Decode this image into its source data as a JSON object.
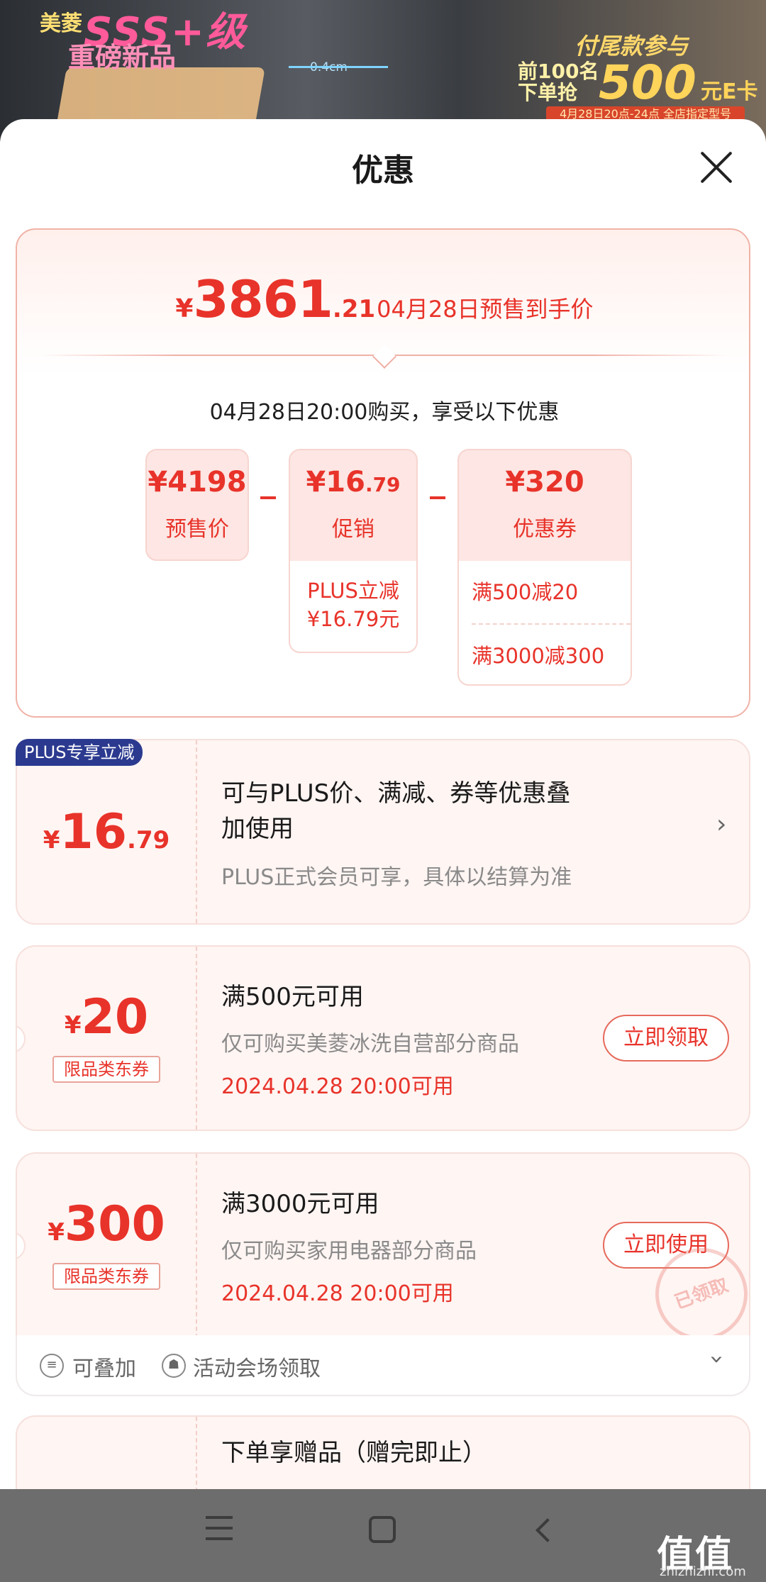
{
  "banner": {
    "left_brand": "美菱",
    "left_big": "SSS+级",
    "left_sub": "重磅新品",
    "middle_text": "0.4cm",
    "right_line1": "付尾款参与",
    "right_line2a": "前100名",
    "right_line2b": "下单抢",
    "right_big": "500",
    "right_unit": "元E卡",
    "right_date": "4月28日20点-24点 全店指定型号"
  },
  "sheet": {
    "title": "优惠"
  },
  "summary": {
    "currency": "¥",
    "price_int": "3861",
    "price_dec": ".21",
    "price_label": "04月28日预售到手价",
    "buy_note": "04月28日20:00购买，享受以下优惠",
    "items": [
      {
        "amount": "¥4198",
        "name": "预售价"
      },
      {
        "amount_int": "¥16",
        "amount_dec": ".79",
        "name": "促销",
        "details": [
          "PLUS立减",
          "¥16.79元"
        ]
      },
      {
        "amount": "¥320",
        "name": "优惠券",
        "details": [
          "满500减20",
          "满3000减300"
        ]
      }
    ]
  },
  "plus_card": {
    "badge": "PLUS专享立减",
    "currency": "¥",
    "amount_int": "16",
    "amount_dec": ".79",
    "title_line1": "可与PLUS价、满减、券等优惠叠",
    "title_line2": "加使用",
    "desc": "PLUS正式会员可享，具体以结算为准"
  },
  "coupon1": {
    "currency": "¥",
    "amount": "20",
    "tag": "限品类东券",
    "title": "满500元可用",
    "desc": "仅可购买美菱冰洗自营部分商品",
    "date": "2024.04.28 20:00可用",
    "action": "立即领取"
  },
  "coupon2": {
    "currency": "¥",
    "amount": "300",
    "tag": "限品类东券",
    "title": "满3000元可用",
    "desc": "仅可购买家用电器部分商品",
    "date": "2024.04.28 20:00可用",
    "action": "立即使用",
    "stamp": "已领取",
    "footer_stackable": "可叠加",
    "footer_source": "活动会场领取"
  },
  "gift_card": {
    "title": "下单享赠品（赠完即止）"
  },
  "watermark": {
    "text": "值值值",
    "sub": "zhizhizhi.com"
  },
  "colors": {
    "accent": "#e8332a",
    "plus_badge": "#2b3a8f"
  }
}
